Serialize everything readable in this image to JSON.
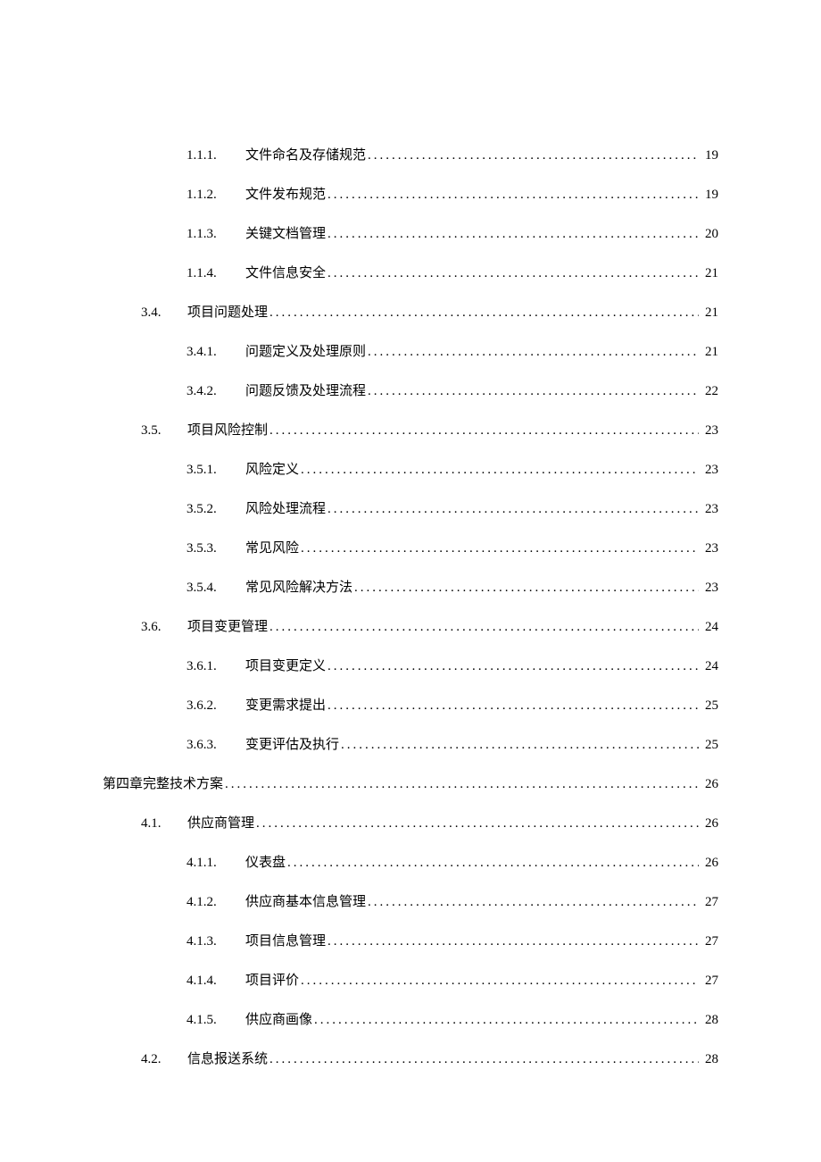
{
  "toc": [
    {
      "level": 3,
      "num": "1.1.1.",
      "title": "文件命名及存储规范",
      "page": "19"
    },
    {
      "level": 3,
      "num": "1.1.2.",
      "title": "文件发布规范",
      "page": "19"
    },
    {
      "level": 3,
      "num": "1.1.3.",
      "title": "关键文档管理",
      "page": "20"
    },
    {
      "level": 3,
      "num": "1.1.4.",
      "title": "文件信息安全",
      "page": "21"
    },
    {
      "level": 2,
      "num": "3.4.",
      "title": "项目问题处理",
      "page": "21"
    },
    {
      "level": 3,
      "num": "3.4.1.",
      "title": "问题定义及处理原则",
      "page": "21"
    },
    {
      "level": 3,
      "num": "3.4.2.",
      "title": "问题反馈及处理流程",
      "page": "22"
    },
    {
      "level": 2,
      "num": "3.5.",
      "title": "项目风险控制",
      "page": "23"
    },
    {
      "level": 3,
      "num": "3.5.1.",
      "title": "风险定义",
      "page": "23"
    },
    {
      "level": 3,
      "num": "3.5.2.",
      "title": "风险处理流程",
      "page": "23"
    },
    {
      "level": 3,
      "num": "3.5.3.",
      "title": "常见风险",
      "page": "23"
    },
    {
      "level": 3,
      "num": "3.5.4.",
      "title": "常见风险解决方法",
      "page": "23"
    },
    {
      "level": 2,
      "num": "3.6.",
      "title": "项目变更管理",
      "page": "24"
    },
    {
      "level": 3,
      "num": "3.6.1.",
      "title": "项目变更定义",
      "page": "24"
    },
    {
      "level": 3,
      "num": "3.6.2.",
      "title": "变更需求提出",
      "page": "25"
    },
    {
      "level": 3,
      "num": "3.6.3.",
      "title": "变更评估及执行",
      "page": "25"
    },
    {
      "level": 1,
      "num": "",
      "title": "第四章完整技术方案",
      "page": "26"
    },
    {
      "level": 2,
      "num": "4.1.",
      "title": "供应商管理",
      "page": "26"
    },
    {
      "level": 3,
      "num": "4.1.1.",
      "title": "仪表盘",
      "page": "26"
    },
    {
      "level": 3,
      "num": "4.1.2.",
      "title": "供应商基本信息管理",
      "page": "27"
    },
    {
      "level": 3,
      "num": "4.1.3.",
      "title": "项目信息管理",
      "page": "27"
    },
    {
      "level": 3,
      "num": "4.1.4.",
      "title": "项目评价",
      "page": "27"
    },
    {
      "level": 3,
      "num": "4.1.5.",
      "title": "供应商画像",
      "page": "28"
    },
    {
      "level": 2,
      "num": "4.2.",
      "title": "信息报送系统",
      "page": "28"
    }
  ]
}
